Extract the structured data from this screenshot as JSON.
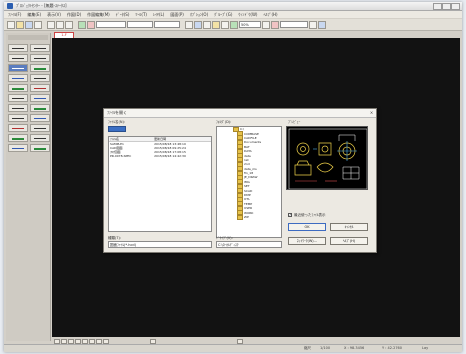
{
  "window": {
    "title": "ﾌﾟﾛｼﾞｪｸﾄｾﾝﾀｰ - [無題-ｽﾃｰﾀｽ]"
  },
  "menu": [
    "ﾌｧｲﾙ(F)",
    "編集(E)",
    "表示(V)",
    "作図(D)",
    "作図編集(M)",
    "ﾃﾞｰﾀ(S)",
    "ﾂｰﾙ(T)",
    "ﾚｲﾔ(L)",
    "図面(P)",
    "ｵﾌﾟｼｮﾝ(O)",
    "ｸﾞﾙｰﾌﾟ(G)",
    "ｳｨﾝﾄﾞｳ(W)",
    "ﾍﾙﾌﾟ(H)"
  ],
  "toolbar": {
    "combo_a": "",
    "combo_b": "",
    "combo_c": "",
    "combo_d": "",
    "zoom": "50%"
  },
  "tab": {
    "label": "1-F"
  },
  "dialog": {
    "title": "ﾌｧｲﾙを開く",
    "close": "×",
    "file_name_label": "ﾌｧｲﾙ名(N):",
    "folder_label": "ﾌｫﾙﾀﾞ(D):",
    "preview_label": "ﾌﾟﾚﾋﾞｭｰ",
    "file_type_label": "種類(T):",
    "file_type_value": "図面ﾌｧｲﾙ(*.hcd)",
    "drive_label": "ﾄﾞﾗｲﾌﾞ(V):",
    "drive_value": "C:\\ﾛｰｶﾙﾃﾞｨｽｸ",
    "file_columns": [
      "ﾌｧｲﾙ名",
      "更新日時"
    ],
    "files": [
      [
        "SAMPLE1",
        "2015/08/18 13:48:10"
      ],
      [
        "CAD图面",
        "2015/08/18 09:25:24"
      ],
      [
        "ﾌﾛｱ図面",
        "2015/08/18 17:08:15"
      ],
      [
        "PR-0078-SPEC",
        "2015/08/18 14:42:30"
      ]
    ],
    "folders": [
      "C:\\",
      "COMBASE",
      "CADFILE",
      "Documents",
      "BAT",
      "DATA",
      "data",
      "1st",
      "2nd",
      "data_ms",
      "fin_18",
      "JE_DRAW",
      "IMG",
      "SET",
      "SCAD",
      "DMP",
      "OTL",
      "TEMP",
      "USER",
      "WORK",
      "ZIP"
    ],
    "checkbox_label": "最近使ったﾌｧｲﾙ表示",
    "checkbox_mark": "✓",
    "ok_label": "OK",
    "cancel_label": "ｷｬﾝｾﾙ",
    "network_label": "ﾈｯﾄﾜｰｸ(W)...",
    "help_label": "ﾍﾙﾌﾟ(H)"
  },
  "status": {
    "mode": "縮尺",
    "scale": "1/100",
    "coord_x": "X : 98.3456",
    "coord_y": "Y : 42.2760",
    "layer": "Lay"
  }
}
